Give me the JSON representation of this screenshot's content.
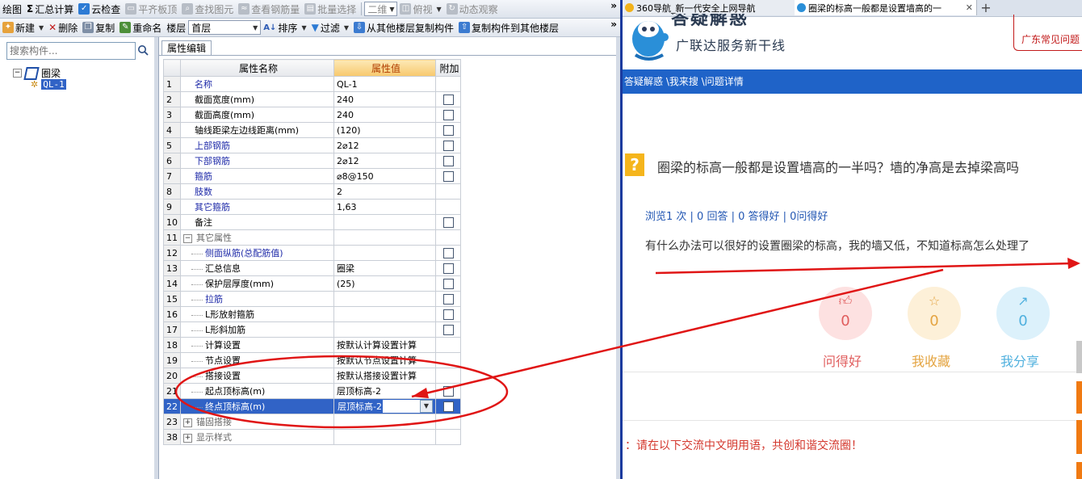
{
  "app": {
    "toolbar1": [
      {
        "label": "绘图",
        "icon": "draw-icon",
        "disabled": false
      },
      {
        "label": "汇总计算",
        "icon": "sigma-icon",
        "disabled": false
      },
      {
        "label": "云检查",
        "icon": "cloud-check-icon",
        "disabled": false
      },
      {
        "label": "平齐板顶",
        "icon": "flush-icon",
        "disabled": true
      },
      {
        "label": "查找图元",
        "icon": "find-icon",
        "disabled": true
      },
      {
        "label": "查看钢筋量",
        "icon": "rebar-icon",
        "disabled": true
      },
      {
        "label": "批量选择",
        "icon": "batch-icon",
        "disabled": true
      }
    ],
    "view_combo": "二维",
    "view_top": "俯视",
    "view_dynamic": "动态观察",
    "more": "»",
    "toolbar2": {
      "new_label": "新建",
      "delete_label": "删除",
      "copy_label": "复制",
      "rename_label": "重命名",
      "floor_label": "楼层",
      "floor_value": "首层",
      "sort_label": "排序",
      "filter_label": "过滤",
      "copy_from_label": "从其他楼层复制构件",
      "copy_to_label": "复制构件到其他楼层"
    },
    "search_placeholder": "搜索构件...",
    "tree": {
      "root": "圈梁",
      "child": "QL-1"
    },
    "grid_tab": "属性编辑",
    "grid": {
      "headers": [
        "属性名称",
        "属性值",
        "附加"
      ],
      "rows": [
        {
          "num": "1",
          "name": "名称",
          "value": "QL-1",
          "style": "blue",
          "check": false
        },
        {
          "num": "2",
          "name": "截面宽度(mm)",
          "value": "240",
          "style": "",
          "check": true
        },
        {
          "num": "3",
          "name": "截面高度(mm)",
          "value": "240",
          "style": "",
          "check": true
        },
        {
          "num": "4",
          "name": "轴线距梁左边线距离(mm)",
          "value": "(120)",
          "style": "",
          "check": true
        },
        {
          "num": "5",
          "name": "上部钢筋",
          "value": "2⌀12",
          "style": "blue",
          "check": true
        },
        {
          "num": "6",
          "name": "下部钢筋",
          "value": "2⌀12",
          "style": "blue",
          "check": true
        },
        {
          "num": "7",
          "name": "箍筋",
          "value": "⌀8@150",
          "style": "blue",
          "check": true
        },
        {
          "num": "8",
          "name": "肢数",
          "value": "2",
          "style": "blue",
          "check": false
        },
        {
          "num": "9",
          "name": "其它箍筋",
          "value": "1,63",
          "style": "blue",
          "check": false
        },
        {
          "num": "10",
          "name": "备注",
          "value": "",
          "style": "",
          "check": true
        },
        {
          "num": "11",
          "name": "其它属性",
          "value": "",
          "style": "group",
          "check": false
        },
        {
          "num": "12",
          "name": "侧面纵筋(总配筋值)",
          "value": "",
          "style": "blue-sub",
          "check": true
        },
        {
          "num": "13",
          "name": "汇总信息",
          "value": "圈梁",
          "style": "sub",
          "check": true
        },
        {
          "num": "14",
          "name": "保护层厚度(mm)",
          "value": "(25)",
          "style": "sub",
          "check": true
        },
        {
          "num": "15",
          "name": "拉筋",
          "value": "",
          "style": "blue-sub",
          "check": true
        },
        {
          "num": "16",
          "name": "L形放射箍筋",
          "value": "",
          "style": "sub",
          "check": true
        },
        {
          "num": "17",
          "name": "L形斜加筋",
          "value": "",
          "style": "sub",
          "check": true
        },
        {
          "num": "18",
          "name": "计算设置",
          "value": "按默认计算设置计算",
          "style": "sub",
          "check": false
        },
        {
          "num": "19",
          "name": "节点设置",
          "value": "按默认节点设置计算",
          "style": "sub",
          "check": false
        },
        {
          "num": "20",
          "name": "搭接设置",
          "value": "按默认搭接设置计算",
          "style": "sub",
          "check": false
        },
        {
          "num": "21",
          "name": "起点顶标高(m)",
          "value": "层顶标高-2",
          "style": "sub",
          "check": true
        },
        {
          "num": "22",
          "name": "终点顶标高(m)",
          "value": "层顶标高-2",
          "style": "selected",
          "check": true
        },
        {
          "num": "23",
          "name": "锚固搭接",
          "value": "",
          "style": "group-collapsed",
          "check": false
        },
        {
          "num": "38",
          "name": "显示样式",
          "value": "",
          "style": "group-collapsed",
          "check": false
        }
      ]
    }
  },
  "browser": {
    "tabs": [
      {
        "label": "360导航_新一代安全上网导航",
        "active": false
      },
      {
        "label": "圈梁的标高一般都是设置墙高的一",
        "active": true
      }
    ],
    "new_tab": "+",
    "brand_title": "答疑解惑",
    "brand_sub": "广联达服务新干线",
    "region_link": "广东常见问题",
    "breadcrumb": "答疑解惑 \\我来搜 \\问题详情",
    "question_mark": "?",
    "question_title": "圈梁的标高一般都是设置墙高的一半吗？墙的净高是去掉梁高吗",
    "stats": "浏览1 次 | 0 回答 | 0 答得好 | 0问得好",
    "body": "有什么办法可以很好的设置圈梁的标高，我的墙又低，不知道标高怎么处理了",
    "actions": [
      {
        "label": "问得好",
        "count": "0",
        "icon": "thumbs-up-icon",
        "color": "#e05d5d"
      },
      {
        "label": "我收藏",
        "count": "0",
        "icon": "star-icon",
        "color": "#e4a441"
      },
      {
        "label": "我分享",
        "count": "0",
        "icon": "share-icon",
        "color": "#4fb0de"
      }
    ],
    "notice": "：请在以下交流中文明用语，共创和谐交流圈！"
  },
  "annotation_color": "#e01515"
}
